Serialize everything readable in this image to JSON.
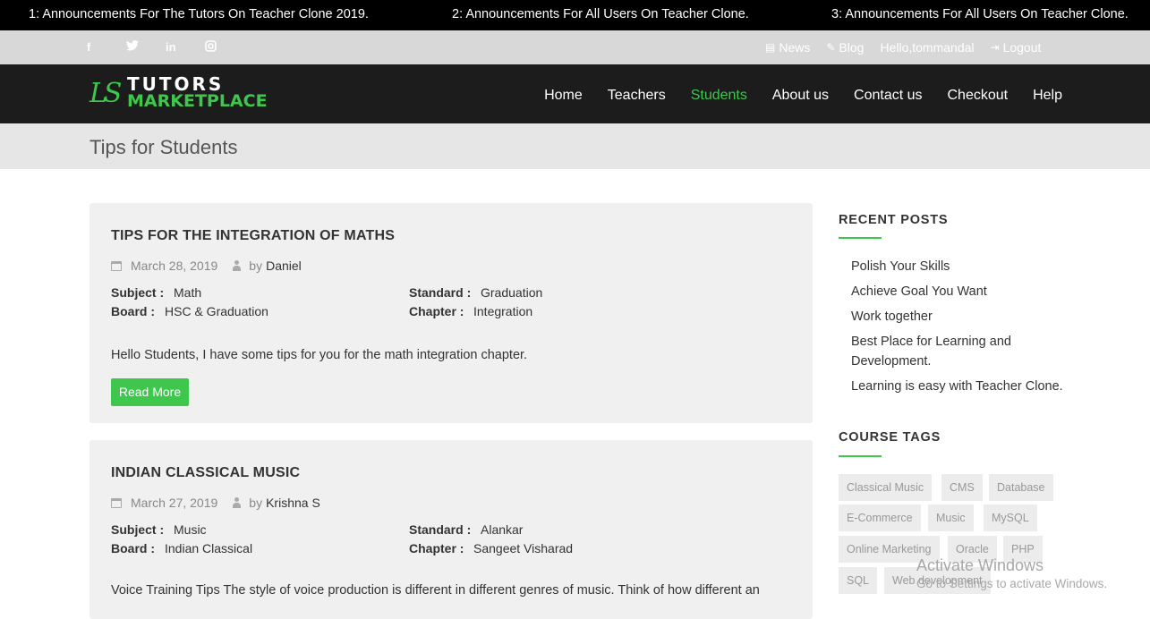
{
  "announcements": [
    "1: Announcements For The Tutors On Teacher Clone 2019.",
    "2: Announcements For All Users On Teacher Clone.",
    "3: Announcements For All Users On Teacher Clone."
  ],
  "topbar": {
    "social": [
      "f",
      "t",
      "in",
      "ig"
    ],
    "news_label": "News",
    "blog_label": "Blog",
    "greeting": "Hello,tommandal",
    "logout_label": "Logout"
  },
  "logo": {
    "mark": "LS",
    "top": "TUTORS",
    "bottom": "MARKETPLACE"
  },
  "nav": [
    "Home",
    "Teachers",
    "Students",
    "About us",
    "Contact us",
    "Checkout",
    "Help"
  ],
  "page": {
    "title": "Tips for Students"
  },
  "posts": [
    {
      "title": "TIPS FOR THE INTEGRATION OF MATHS",
      "date": "March 28, 2019",
      "by": "by",
      "author": "Daniel",
      "subject_label": "Subject :",
      "subject": "Math",
      "standard_label": "Standard :",
      "standard": "Graduation",
      "board_label": "Board :",
      "board": "HSC & Graduation",
      "chapter_label": "Chapter :",
      "chapter": "Integration",
      "excerpt": "Hello Students, I have some tips for you for the math integration chapter.",
      "read_more": "Read More"
    },
    {
      "title": "INDIAN CLASSICAL MUSIC",
      "date": "March 27, 2019",
      "by": "by",
      "author": "Krishna S",
      "subject_label": "Subject :",
      "subject": "Music",
      "standard_label": "Standard :",
      "standard": "Alankar",
      "board_label": "Board :",
      "board": "Indian Classical",
      "chapter_label": "Chapter :",
      "chapter": "Sangeet Visharad",
      "excerpt": "Voice Training Tips The style of voice production is different in different genres of music. Think of how different an"
    }
  ],
  "sidebar": {
    "recent_heading": "RECENT POSTS",
    "recent": [
      "Polish Your Skills",
      "Achieve Goal You Want",
      "Work together",
      "Best Place for Learning and Development.",
      "Learning is easy with Teacher Clone."
    ],
    "tags_heading": "COURSE TAGS",
    "tags": [
      "Classical Music",
      "CMS",
      "Database",
      "E-Commerce",
      "Music",
      "MySQL",
      "Online Marketing",
      "Oracle",
      "PHP",
      "SQL",
      "Web development"
    ]
  },
  "watermark": {
    "line1": "Activate Windows",
    "line2": "Go to Settings to activate Windows."
  }
}
